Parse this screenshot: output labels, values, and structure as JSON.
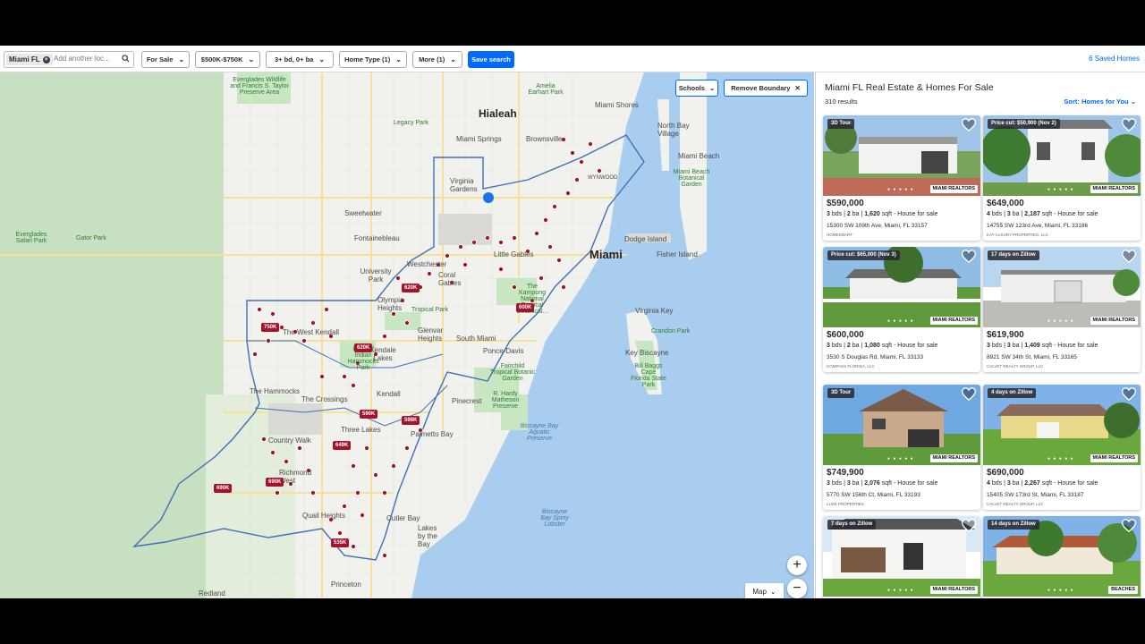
{
  "topbar": {
    "location_chip": "Miami FL",
    "location_placeholder": "Add another loc...",
    "filters": [
      {
        "label": "For Sale"
      },
      {
        "label": "$500K-$750K"
      },
      {
        "label": "3+ bd, 0+ ba"
      },
      {
        "label": "Home Type (1)"
      },
      {
        "label": "More (1)"
      }
    ],
    "save_search": "Save search",
    "saved_homes": "6 Saved Homes"
  },
  "map": {
    "schools_label": "Schools",
    "remove_boundary_label": "Remove Boundary",
    "map_type_label": "Map",
    "zoom_in": "+",
    "zoom_out": "−",
    "labels": {
      "hialeah": "Hialeah",
      "miami": "Miami",
      "miami_shores": "Miami Shores",
      "north_bay_village": "North Bay Village",
      "miami_beach": "Miami Beach",
      "miami_springs": "Miami Springs",
      "virginia_gardens": "Virginia Gardens",
      "sweetwater": "Sweetwater",
      "fontainebleau": "Fontainebleau",
      "westchester": "Westchester",
      "coral_gables": "Coral Gables",
      "little_gables": "Little Gables",
      "university_park": "University Park",
      "olympia_heights": "Olympia Heights",
      "west_kendall": "The West Kendall",
      "kendale_lakes": "Kendale Lakes",
      "south_miami": "South Miami",
      "glenvar_heights": "Glenvar Heights",
      "ponce_davis": "Ponce-Davis",
      "the_hammocks": "The Hammocks",
      "the_crossings": "The Crossings",
      "kendall": "Kendall",
      "pinecrest": "Pinecrest",
      "three_lakes": "Three Lakes",
      "country_walk": "Country Walk",
      "palmetto_bay": "Palmetto Bay",
      "richmond_west": "Richmond West",
      "quail_heights": "Quail Heights",
      "cutler_bay": "Cutler Bay",
      "lakes_by_the_bay": "Lakes by the Bay",
      "redland": "Redland",
      "princeton": "Princeton",
      "key_biscayne": "Key Biscayne",
      "fisher_island": "Fisher Island",
      "virginia_key": "Virginia Key",
      "dodge_island": "Dodge Island",
      "miami_gardens_park": "Miami Beach Botanical Garden",
      "everglades_wildlife": "Everglades Wildlife and Francis S. Taylor Preserve Area",
      "everglades_safari": "Everglades Safari Park",
      "gator_park": "Gator Park",
      "biscayne_aquatic": "Biscayne Bay Aquatic Preserve",
      "biscayne_lobster": "Biscayne Bay Spiny Lobster",
      "crandon_park": "Crandon Park",
      "bill_baggs": "Bill Baggs Cape Florida State Park",
      "kampong": "The Kampong National Tropical Botanical...",
      "fairchild": "Fairchild Tropical Botanic Garden",
      "r_hardy": "R. Hardy Matheson Preserve",
      "amelia": "Amelia Earhart Park",
      "legacy_park": "Legacy Park",
      "tropical_park": "Tropical Park",
      "kendall_indian": "Kendall Indian Hammocks Park",
      "hall_of_fame": "Miami Beach",
      "brownsville": "Brownsville",
      "wynwood": "WYNWOOD"
    },
    "price_pins": [
      "620K",
      "750K",
      "620K",
      "600K",
      "590K",
      "598K",
      "649K",
      "690K",
      "690K",
      "535K"
    ]
  },
  "list": {
    "title": "Miami FL Real Estate & Homes For Sale",
    "results": "310 results",
    "sort": "Sort: Homes for You",
    "cards": [
      {
        "badge": "3D Tour",
        "price": "$590,000",
        "beds": "3",
        "baths": "2",
        "sqft": "1,620",
        "type": "House for sale",
        "address": "15300 SW 109th Ave, Miami, FL 33157",
        "broker": "HOMESMART",
        "brand": "MIAMI REALTORS"
      },
      {
        "badge": "Price cut: $50,900 (Nov 2)",
        "price": "$649,000",
        "beds": "4",
        "baths": "3",
        "sqft": "2,187",
        "type": "House for sale",
        "address": "14755 SW 123rd Ave, Miami, FL 33186",
        "broker": "KAY LUXURY PROPERTIES, LLC",
        "brand": "MIAMI REALTORS"
      },
      {
        "badge": "Price cut: $65,000 (Nov 3)",
        "price": "$600,000",
        "beds": "3",
        "baths": "2",
        "sqft": "1,080",
        "type": "House for sale",
        "address": "3530 S Douglas Rd, Miami, FL 33133",
        "broker": "COMPASS FLORIDA, LLC",
        "brand": "MIAMI REALTORS"
      },
      {
        "badge": "17 days on Zillow",
        "price": "$619,900",
        "beds": "3",
        "baths": "3",
        "sqft": "1,409",
        "type": "House for sale",
        "address": "8921 SW 34th St, Miami, FL 33165",
        "broker": "CALVET REALTY GROUP, LLC",
        "brand": "MIAMI REALTORS"
      },
      {
        "badge": "3D Tour",
        "price": "$749,900",
        "beds": "3",
        "baths": "3",
        "sqft": "2,076",
        "type": "House for sale",
        "address": "5770 SW 156th Ct, Miami, FL 33193",
        "broker": "LUXE PROPERTIES",
        "brand": "MIAMI REALTORS"
      },
      {
        "badge": "4 days on Zillow",
        "price": "$690,000",
        "beds": "4",
        "baths": "3",
        "sqft": "2,267",
        "type": "House for sale",
        "address": "15405 SW 173rd St, Miami, FL 33187",
        "broker": "CALVET REALTY GROUP, LLC",
        "brand": "MIAMI REALTORS"
      },
      {
        "badge": "7 days on Zillow",
        "brand": "MIAMI REALTORS"
      },
      {
        "badge": "14 days on Zillow",
        "brand": "BEACHES"
      }
    ],
    "unit_bds": "bds",
    "unit_ba": "ba",
    "unit_sqft": "sqft",
    "sep": "-"
  },
  "colors": {
    "accent": "#006aff",
    "pin": "#a3132b",
    "water": "#a9cdee",
    "green": "#c8e6c1",
    "boundary": "#3f6fb8"
  }
}
